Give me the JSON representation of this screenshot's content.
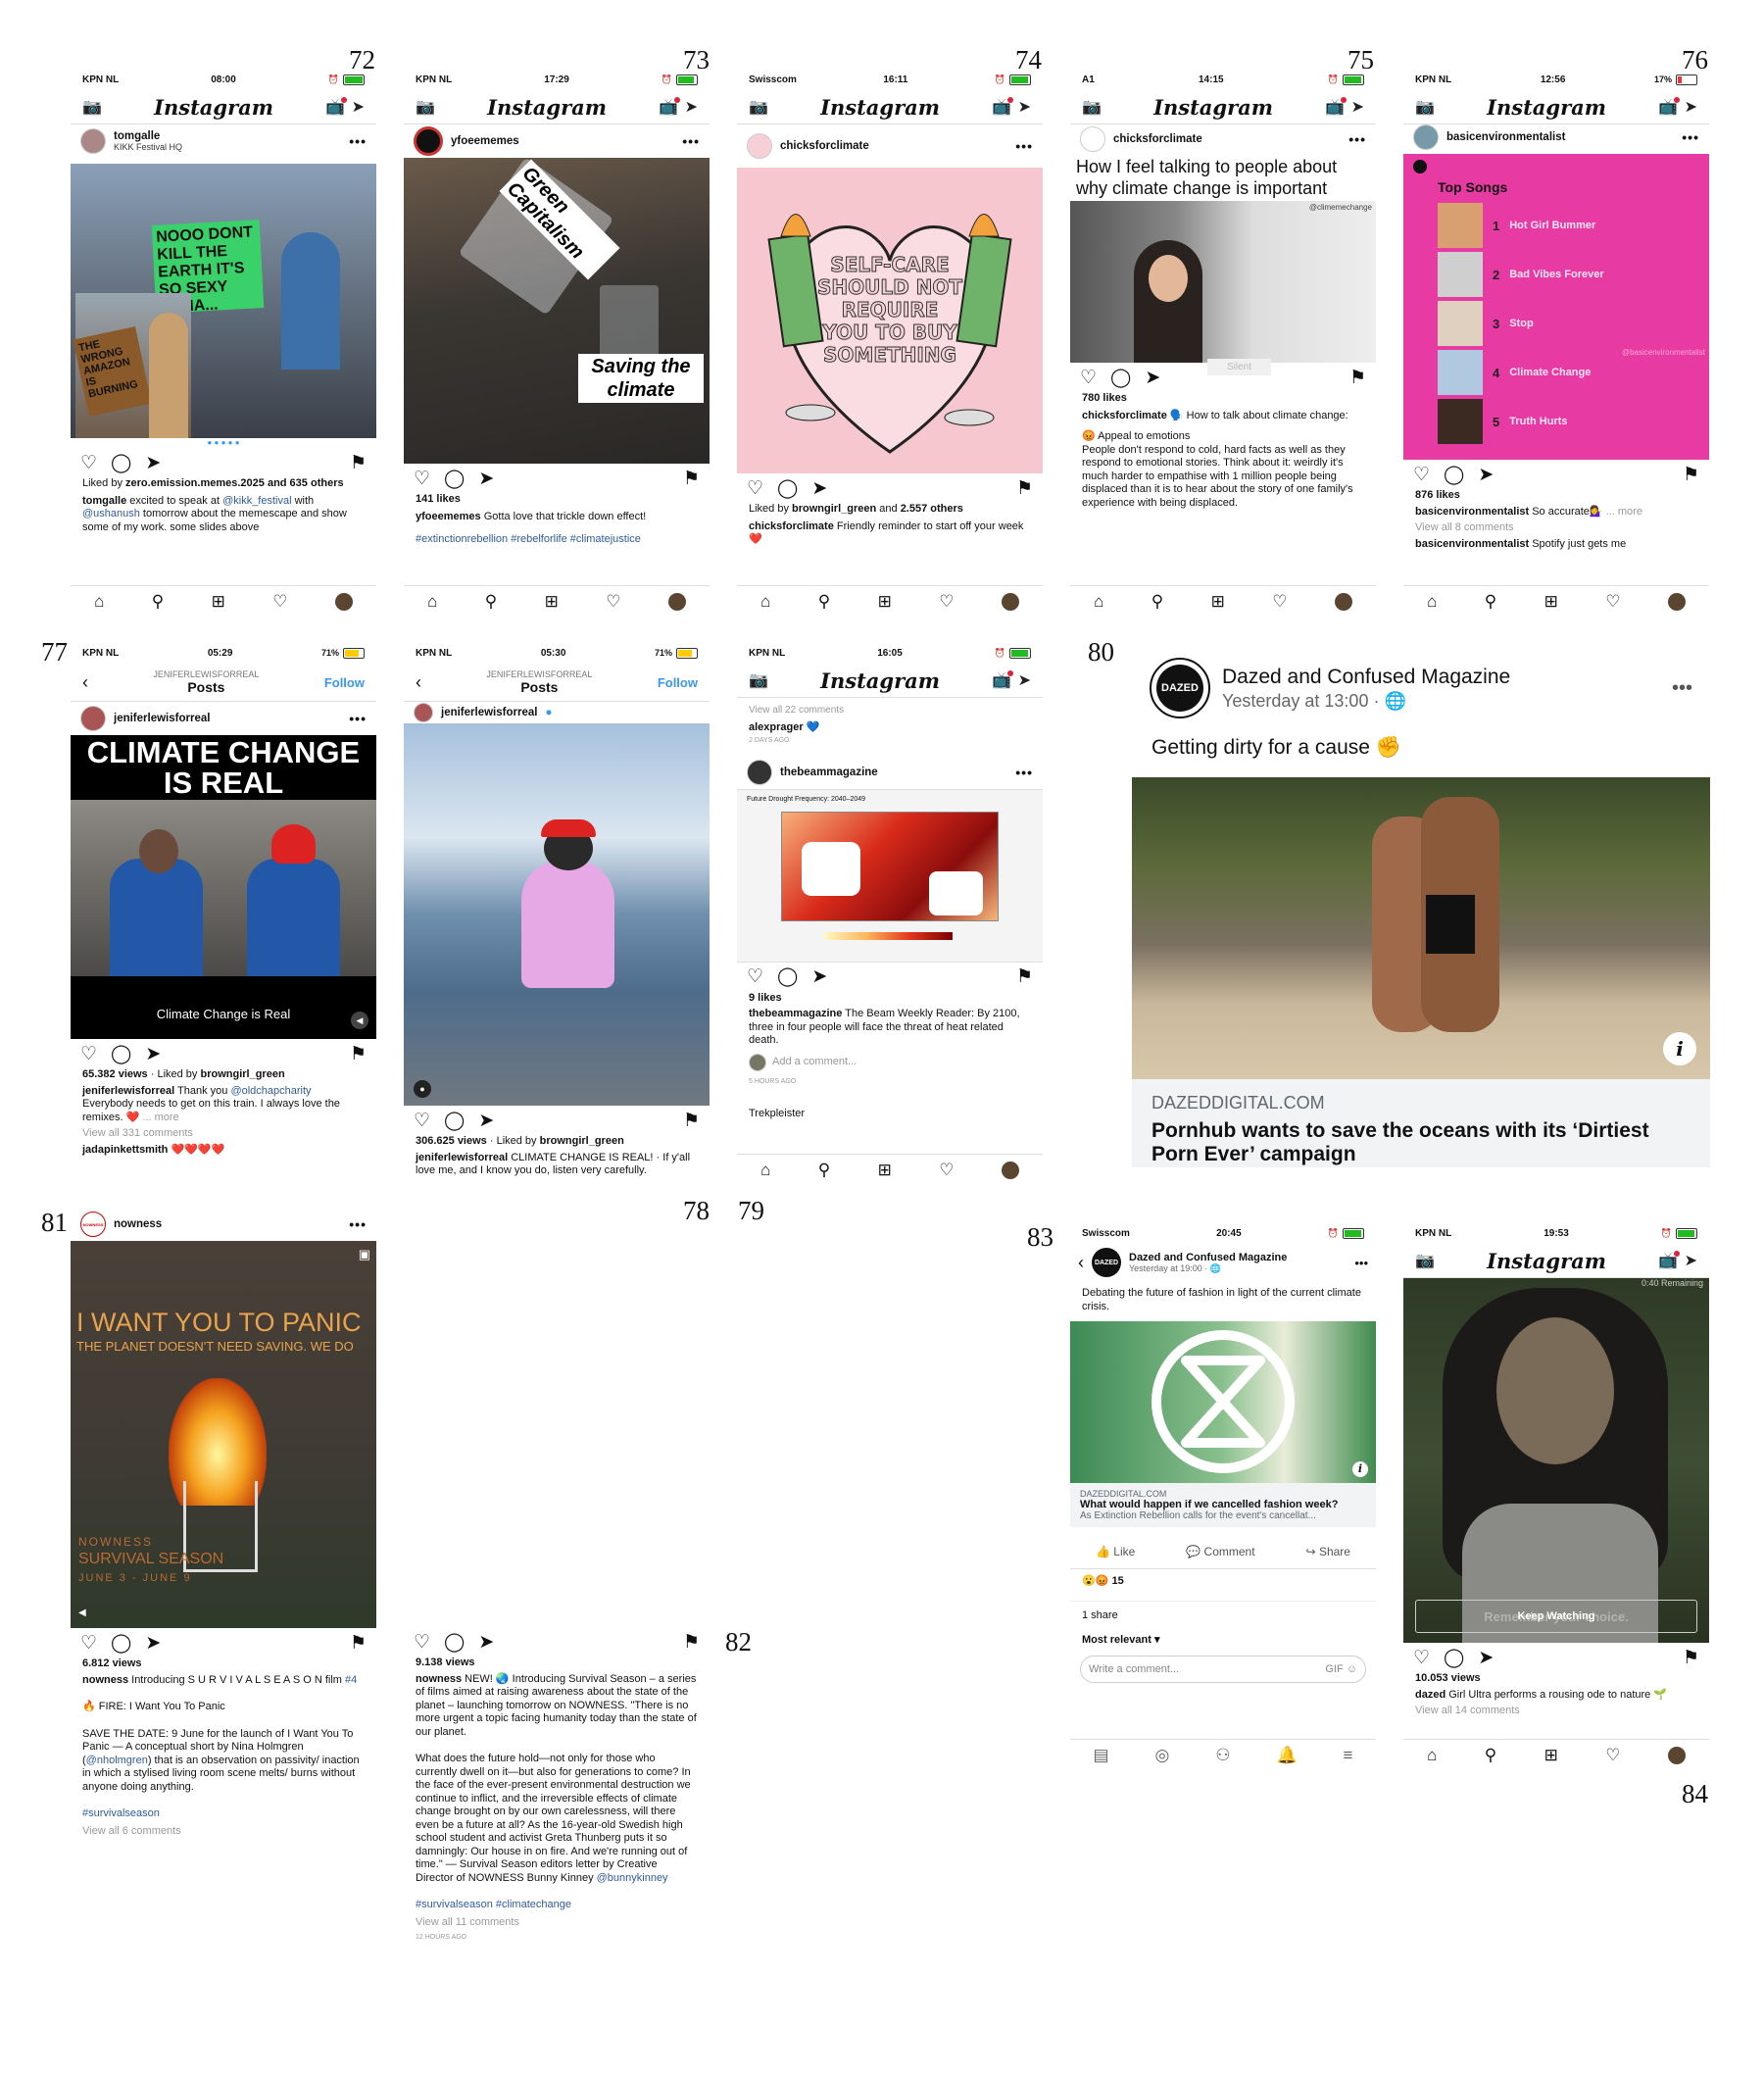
{
  "labels": {
    "n72": "72",
    "n73": "73",
    "n74": "74",
    "n75": "75",
    "n76": "76",
    "n77": "77",
    "n78": "78",
    "n79": "79",
    "n80": "80",
    "n81": "81",
    "n82": "82",
    "n83": "83",
    "n84": "84"
  },
  "common": {
    "ig_logo": "Instagram",
    "more": "•••"
  },
  "s72": {
    "carrier": "KPN NL",
    "time": "08:00",
    "user": "tomgalle",
    "sub": "KIKK Festival HQ",
    "sign1": "NOOO DONT KILL THE EARTH IT'S SO SEXY HAHA...",
    "sign2": "THE WRONG AMAZON IS BURNING",
    "liked_pre": "Liked by ",
    "liked_user": "zero.emission.memes.2025",
    "liked_post": " and 635 others",
    "cap_user": "tomgalle",
    "cap1": " excited to speak at ",
    "cap_m1": "@kikk_festival",
    "cap2": " with ",
    "cap_m2": "@ushanush",
    "cap3": " tomorrow about the memescape and show some of my work. some slides above"
  },
  "s73": {
    "carrier": "KPN NL",
    "time": "17:29",
    "user": "yfoeememes",
    "top": "Green Capitalism",
    "bottom": "Saving the climate",
    "likes": "141 likes",
    "cap_user": "yfoeememes",
    "cap": " Gotta love that trickle down effect!",
    "tags": "#extinctionrebellion #rebelforlife #climatejustice"
  },
  "s74": {
    "carrier": "Swisscom",
    "time": "16:11",
    "user": "chicksforclimate",
    "heart": "SELF-CARE SHOULD NOT REQUIRE YOU TO BUY SOMETHING",
    "liked_pre": "Liked by ",
    "liked_user": "browngirl_green",
    "liked_mid": " and ",
    "liked_count": "2.557 others",
    "cap_user": "chicksforclimate",
    "cap": " Friendly reminder to start off your week ❤️"
  },
  "s75": {
    "carrier": "A1",
    "time": "14:15",
    "user": "chicksforclimate",
    "headline": "How I feel talking to people about why climate change is important",
    "watermark": "@climemechange",
    "silent": "Silent",
    "likes": "780 likes",
    "cap_user": "chicksforclimate",
    "cap1": " 🗣️ How to talk about climate change:",
    "cap2": "😡 Appeal to emotions",
    "cap3": "People don't respond to cold, hard facts as well as they respond to emotional stories. Think about it: weirdly it's much harder to empathise with 1 million people being displaced than it is to hear about the story of one family's experience with being displaced."
  },
  "s76": {
    "carrier": "KPN NL",
    "time": "12:56",
    "battery": "17%",
    "user": "basicenvironmentalist",
    "top": "Top Songs",
    "songs": [
      {
        "n": "1",
        "t": "Hot Girl Bummer"
      },
      {
        "n": "2",
        "t": "Bad Vibes Forever"
      },
      {
        "n": "3",
        "t": "Stop"
      },
      {
        "n": "4",
        "t": "Climate Change"
      },
      {
        "n": "5",
        "t": "Truth Hurts"
      }
    ],
    "wm": "@basicenvironmentalist",
    "likes": "876 likes",
    "cap_user": "basicenvironmentalist",
    "cap": " So accurate💁‍♀️",
    "more": "... more",
    "view": "View all 8 comments",
    "c_user": "basicenvironmentalist",
    "c": " Spotify just gets me"
  },
  "s77": {
    "carrier": "KPN NL",
    "time": "05:29",
    "battery": "71%",
    "acct": "JENIFERLEWISFORREAL",
    "posts": "Posts",
    "follow": "Follow",
    "user": "jeniferlewisforreal",
    "title": "CLIMATE CHANGE IS REAL",
    "subtitle": "Climate Change is Real",
    "views": "65.382 views",
    "liked_pre": " · Liked by ",
    "liked_user": "browngirl_green",
    "cap_user": "jeniferlewisforreal",
    "cap1": " Thank you ",
    "cap_m": "@oldchapcharity",
    "cap2": "Everybody needs to get on this train. I always love the remixes. ❤️",
    "more": "... more",
    "view": "View all 331 comments",
    "c_user": "jadapinkettsmith",
    "c": " ❤️❤️❤️❤️"
  },
  "s78": {
    "carrier": "KPN NL",
    "time": "05:30",
    "battery": "71%",
    "acct": "JENIFERLEWISFORREAL",
    "posts": "Posts",
    "follow": "Follow",
    "user": "jeniferlewisforreal",
    "views": "306.625 views",
    "liked_pre": " · Liked by ",
    "liked_user": "browngirl_green",
    "cap_user": "jeniferlewisforreal",
    "cap": " CLIMATE CHANGE IS REAL! · If y'all love me, and I know you do, listen very carefully."
  },
  "s79": {
    "carrier": "KPN NL",
    "time": "16:05",
    "view": "View all 22 comments",
    "c_user": "alexprager",
    "c": " 💙",
    "ago1": "2 DAYS AGO",
    "user": "thebeammagazine",
    "map_title": "Future Drought Frequency: 2040–2049",
    "likes": "9 likes",
    "cap_user": "thebeammagazine",
    "cap": " The Beam Weekly Reader: By 2100, three in four people will face the threat of heat related death.",
    "add": "Add a comment...",
    "ago2": "5 HOURS AGO",
    "next": "Trekpleister"
  },
  "s80": {
    "page": "Dazed and Confused Magazine",
    "badge": "DAZED",
    "time": "Yesterday at 13:00 · 🌐",
    "text": "Getting dirty for a cause ✊",
    "domain": "DAZEDDIGITAL.COM",
    "headline": "Pornhub wants to save the oceans with its ‘Dirtiest Porn Ever’ campaign"
  },
  "s81": {
    "user": "nowness",
    "logo": "NOWNESS",
    "title": "I WANT YOU TO PANIC",
    "sub": "THE PLANET DOESN'T NEED SAVING. WE DO",
    "brand": "NOWNESS",
    "season": "SURVIVAL SEASON",
    "dates": "JUNE 3 - JUNE 9",
    "views": "6.812 views",
    "cap_user": "nowness",
    "cap1": " Introducing S U R V I V A L  S E A S O N film ",
    "cap_tag": "#4",
    "fire": "🔥 FIRE: I Want You To Panic",
    "save1": "SAVE THE DATE: 9 June for the launch of I Want You To Panic — A conceptual short by Nina Holmgren (",
    "save_m": "@nholmgren",
    "save2": ") that is an observation on passivity/ inaction in which a stylised living room scene melts/ burns without anyone doing anything.",
    "tags": "#survivalseason",
    "view": "View all 6 comments"
  },
  "s82": {
    "views": "9.138 views",
    "cap_user": "nowness",
    "cap": " NEW! 🌏 Introducing Survival Season – a series of films aimed at raising awareness about the state of the planet – launching tomorrow on NOWNESS.     \"There is no more urgent a topic facing humanity today than the state of our planet.",
    "cap2": "What does the future hold—not only for those who currently dwell on it—but also for generations to come? In the face of the ever-present environmental destruction we continue to inflict, and the irreversible effects of climate change brought on by our own carelessness, will there even be a future at all? As the 16-year-old Swedish high school student and activist Greta Thunberg puts it so damningly: Our house in on fire. And we're running out of time.\" — Survival Season editors letter by Creative Director of NOWNESS Bunny Kinney ",
    "cap_m": "@bunnykinney",
    "tags": "#survivalseason #climatechange",
    "view": "View all 11 comments",
    "ago": "12 HOURS AGO"
  },
  "s83": {
    "carrier": "Swisscom",
    "time": "20:45",
    "page": "Dazed and Confused Magazine",
    "badge": "DAZED",
    "ptime": "Yesterday at 19:00 · 🌐",
    "text": "Debating the future of fashion in light of the current climate crisis.",
    "domain": "DAZEDDIGITAL.COM",
    "headline": "What would happen if we cancelled fashion week?",
    "desc": "As Extinction Rebellion calls for the event's cancellat...",
    "like": "Like",
    "comment": "Comment",
    "share": "Share",
    "reacts": "15",
    "shares": "1 share",
    "relevant": "Most relevant",
    "write": "Write a comment..."
  },
  "s84": {
    "carrier": "KPN NL",
    "time": "19:53",
    "remaining": "0:40 Remaining",
    "keep": "Keep Watching",
    "behind": "Remember your choice.",
    "views": "10.053 views",
    "cap_user": "dazed",
    "cap": " Girl Ultra performs a rousing ode to nature 🌱",
    "view": "View all 14 comments"
  },
  "colors": {
    "pink": "#e83aa3",
    "ig_blue": "#3897f0",
    "link": "#2f5a9e",
    "heart_pink": "#f6c7cf"
  }
}
